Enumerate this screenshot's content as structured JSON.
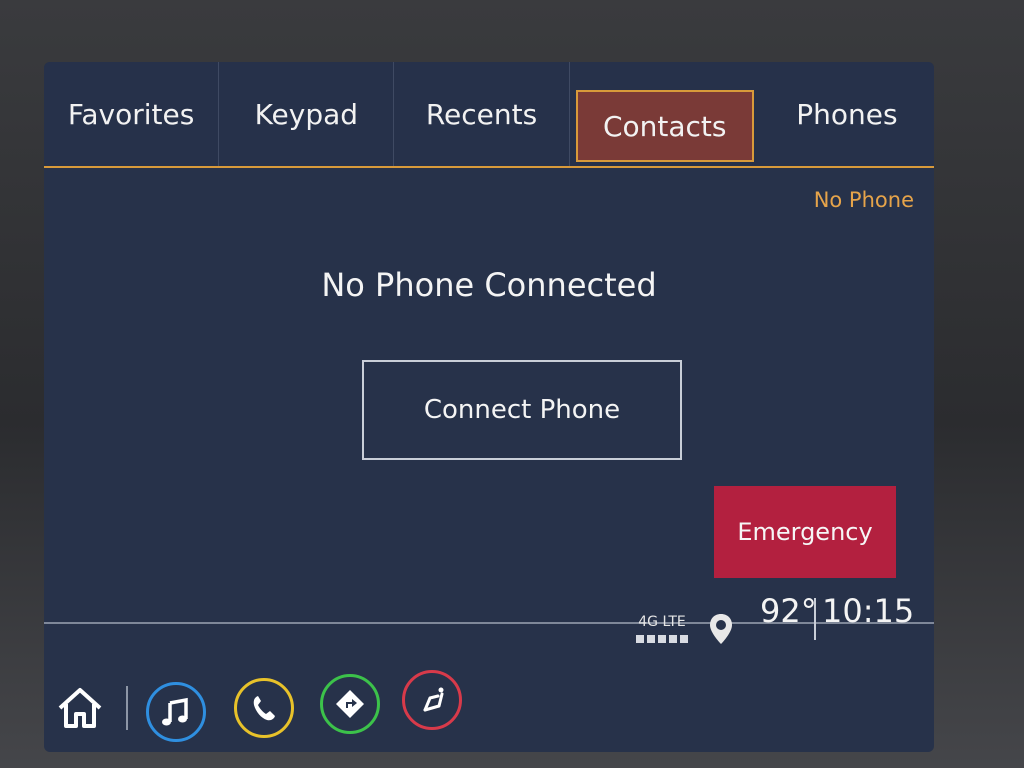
{
  "tabs": [
    {
      "label": "Favorites"
    },
    {
      "label": "Keypad"
    },
    {
      "label": "Recents"
    },
    {
      "label": "Contacts",
      "active": true
    },
    {
      "label": "Phones"
    }
  ],
  "status": {
    "phone_state": "No Phone"
  },
  "main": {
    "headline": "No Phone Connected",
    "connect_button": "Connect Phone",
    "emergency_button": "Emergency"
  },
  "statusbar": {
    "network": "4G LTE",
    "signal_bars": 5,
    "temperature": "92°",
    "time": "10:15",
    "icons": [
      "signal-icon",
      "location-pin-icon"
    ]
  },
  "dock": {
    "icons": [
      "home-icon",
      "audio-icon",
      "phone-icon",
      "navigation-icon",
      "seat-icon"
    ],
    "colors": {
      "audio": "#2f8fe0",
      "phone": "#e8c22a",
      "navigation": "#3cc24a",
      "seat": "#d83a4a"
    }
  },
  "colors": {
    "accent": "#d89a3a",
    "active_tab": "#7a3a37",
    "emergency": "#b3203f",
    "screen_bg": "#27324a"
  }
}
